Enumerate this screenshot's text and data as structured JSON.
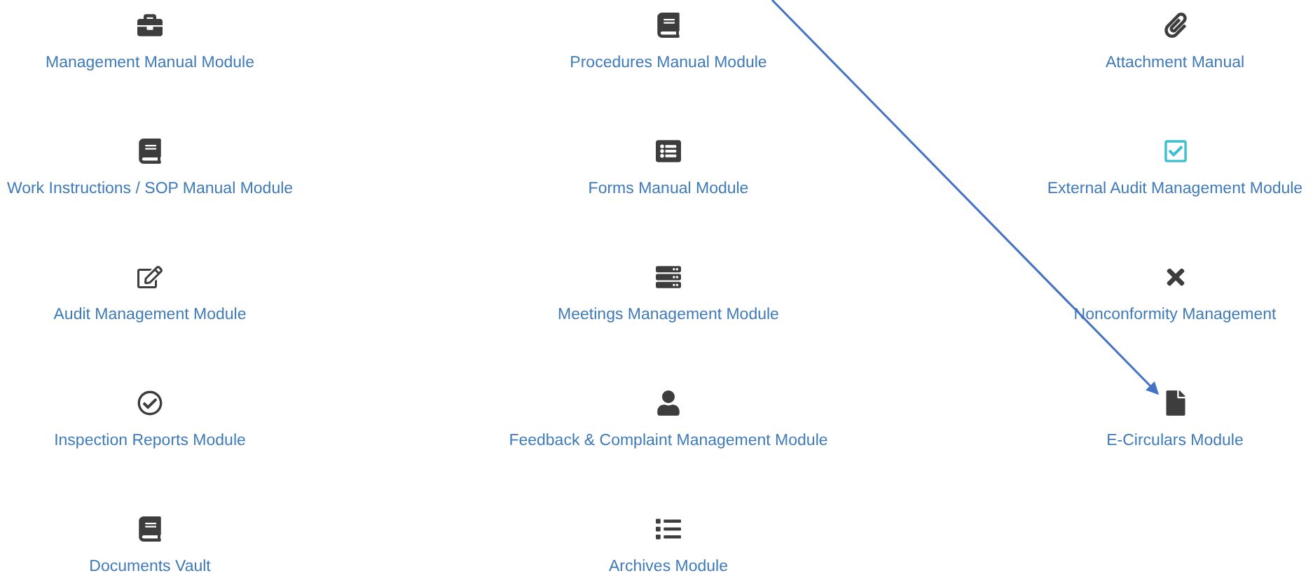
{
  "modules": [
    {
      "label": "Management Manual Module",
      "kind": "briefcase",
      "color": "#3d3d3d"
    },
    {
      "label": "Procedures Manual Module",
      "kind": "book",
      "color": "#3d3d3d"
    },
    {
      "label": "Attachment Manual",
      "kind": "paperclip",
      "color": "#3d3d3d"
    },
    {
      "label": "Work Instructions / SOP Manual Module",
      "kind": "book",
      "color": "#3d3d3d"
    },
    {
      "label": "Forms Manual Module",
      "kind": "form",
      "color": "#3d3d3d"
    },
    {
      "label": "External Audit Management Module",
      "kind": "checkbox",
      "color": "#3bbfcf"
    },
    {
      "label": "Audit Management Module",
      "kind": "edit",
      "color": "#3d3d3d"
    },
    {
      "label": "Meetings Management Module",
      "kind": "server",
      "color": "#3d3d3d"
    },
    {
      "label": "Nonconformity Management",
      "kind": "cross",
      "color": "#3d3d3d"
    },
    {
      "label": "Inspection Reports Module",
      "kind": "check-circle",
      "color": "#3d3d3d"
    },
    {
      "label": "Feedback & Complaint Management Module",
      "kind": "user",
      "color": "#3d3d3d"
    },
    {
      "label": "E-Circulars Module",
      "kind": "file",
      "color": "#3d3d3d"
    },
    {
      "label": "Documents Vault",
      "kind": "book",
      "color": "#3d3d3d"
    },
    {
      "label": "Archives Module",
      "kind": "list",
      "color": "#3d3d3d"
    }
  ]
}
